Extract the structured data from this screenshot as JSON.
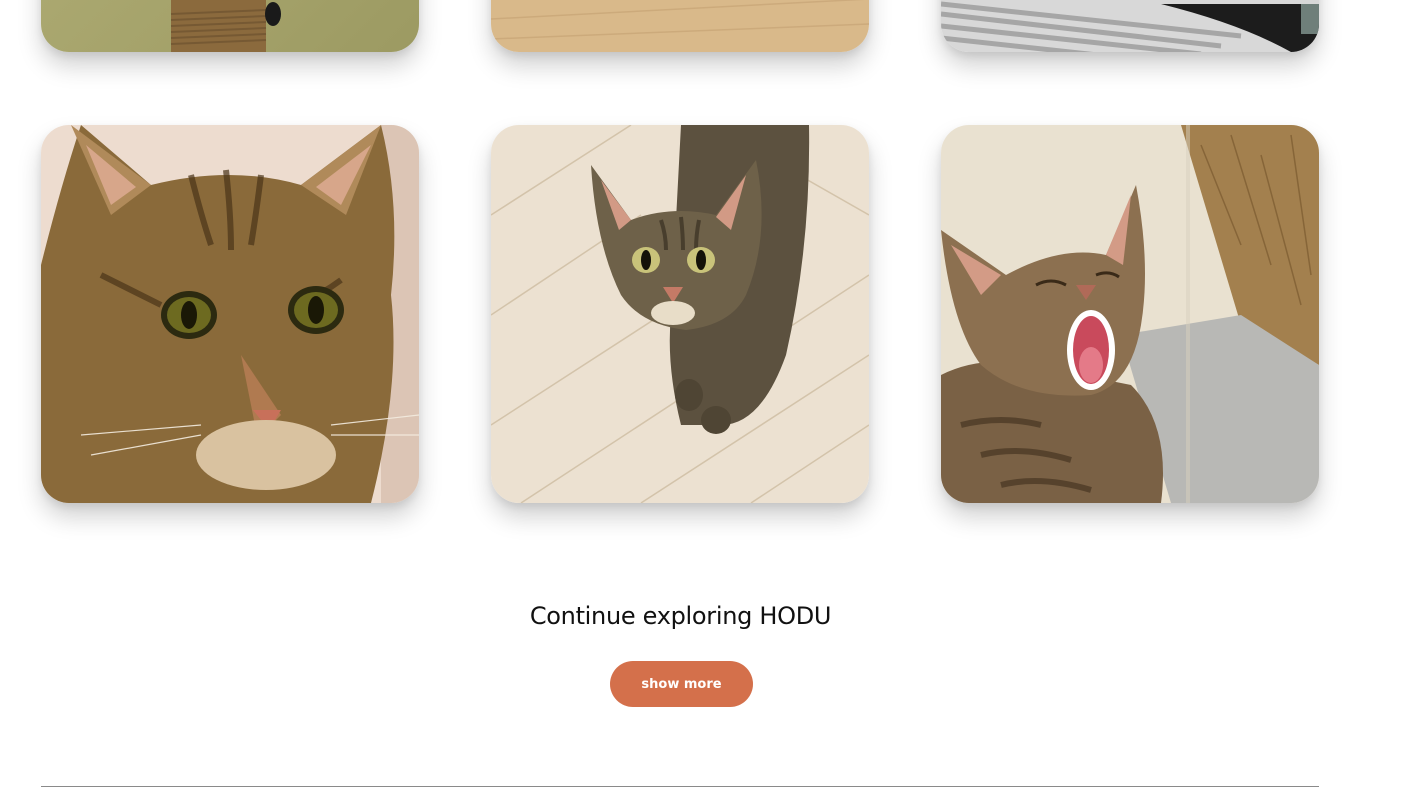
{
  "gallery": {
    "photos": [
      {
        "subject": "tabby cat on scratching post",
        "row": "top"
      },
      {
        "subject": "wooden floor",
        "row": "top"
      },
      {
        "subject": "gray striped blanket",
        "row": "top"
      },
      {
        "subject": "tabby cat close-up face",
        "row": "bottom"
      },
      {
        "subject": "tabby cat looking up on wooden floor",
        "row": "bottom"
      },
      {
        "subject": "tabby cat yawning in sunlight",
        "row": "bottom"
      }
    ]
  },
  "cta": {
    "title": "Continue exploring HODU",
    "button_label": "show more"
  },
  "colors": {
    "accent": "#d4704b",
    "divider": "#8a8a8a"
  }
}
